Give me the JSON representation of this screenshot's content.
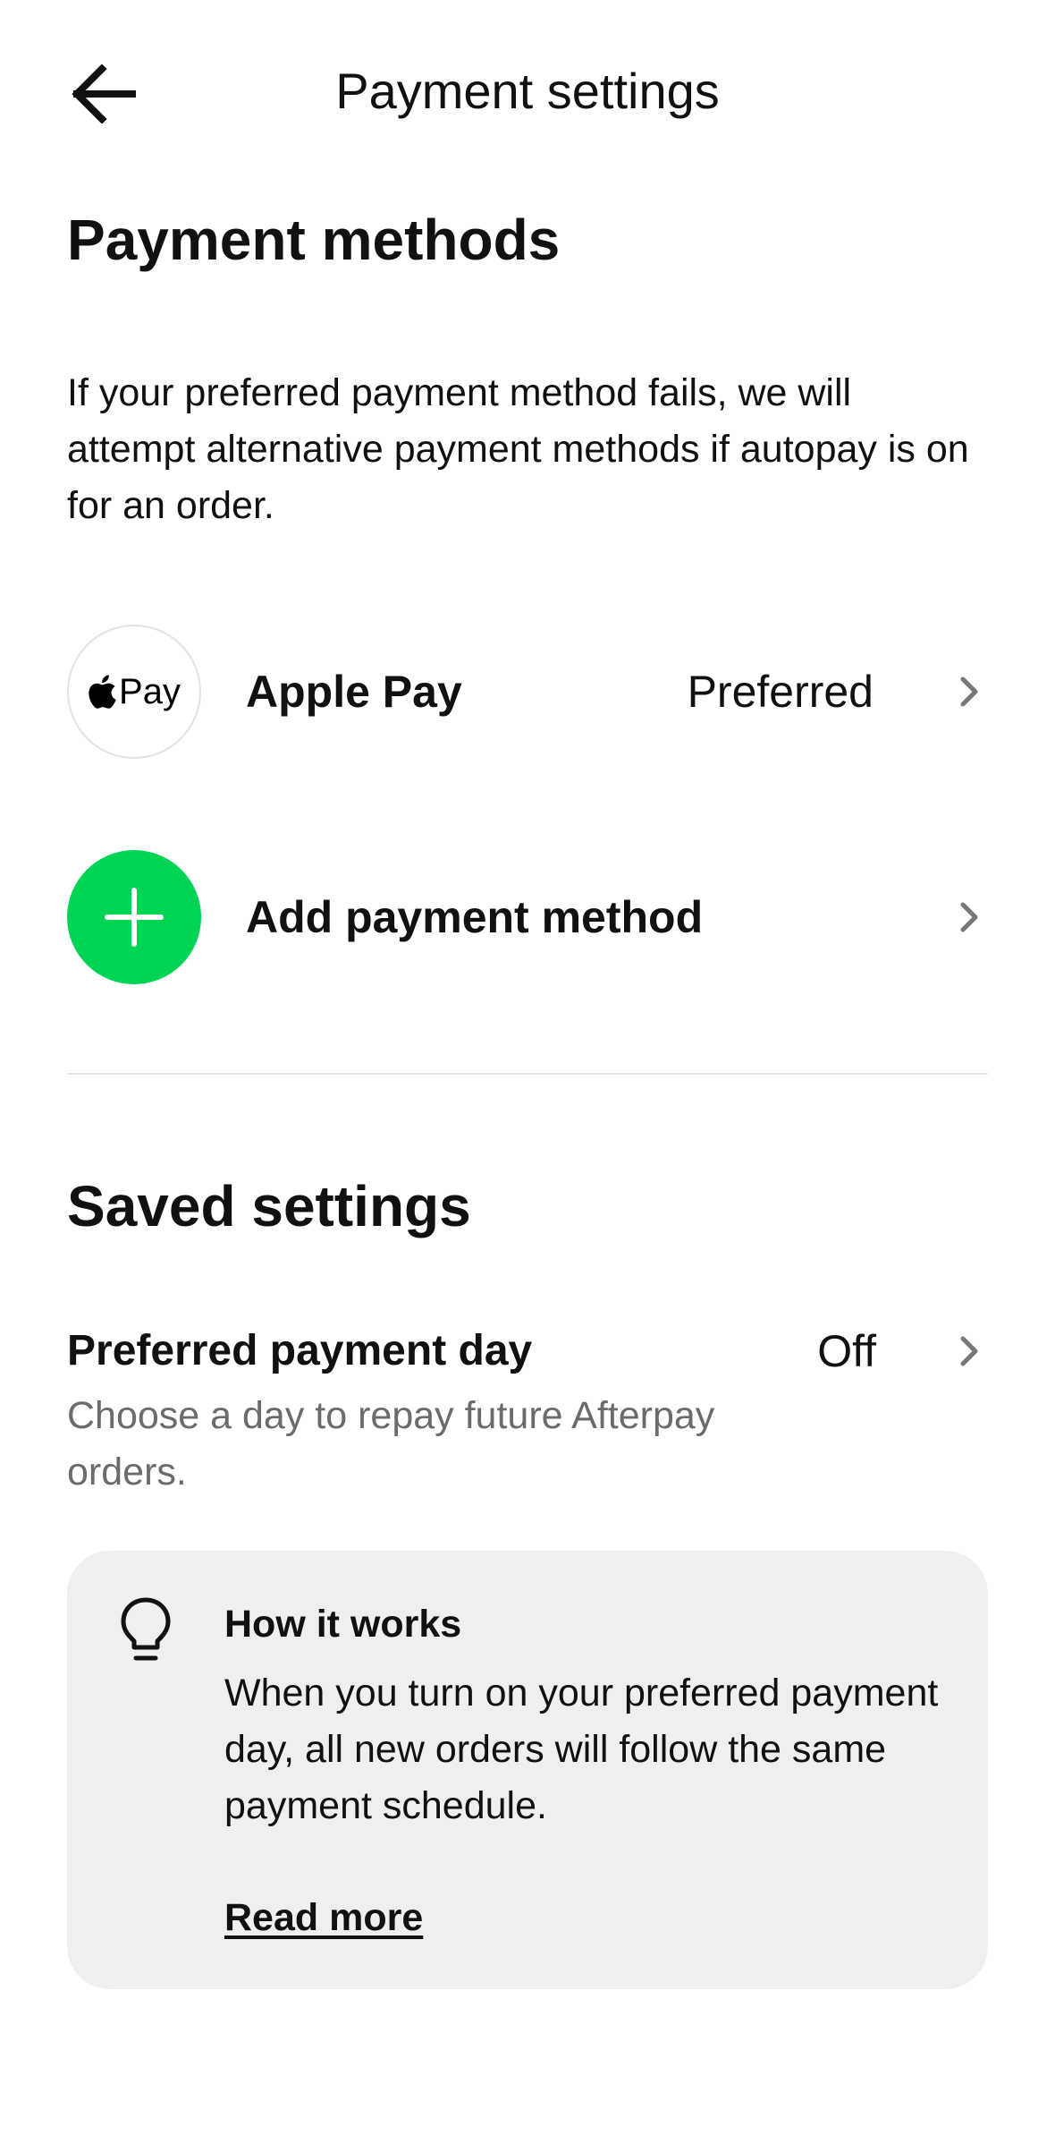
{
  "header": {
    "title": "Payment settings"
  },
  "payment_methods": {
    "heading": "Payment methods",
    "description": "If your preferred payment method fails, we will attempt alternative payment methods if autopay is on for an order.",
    "items": [
      {
        "logo_text": "Pay",
        "label": "Apple Pay",
        "status": "Preferred",
        "icon": "apple-logo-icon"
      }
    ],
    "add_label": "Add payment method",
    "add_color": "#00d455"
  },
  "saved_settings": {
    "heading": "Saved settings",
    "preferred_day": {
      "title": "Preferred payment day",
      "subtitle": "Choose a day to repay future Afterpay orders.",
      "value": "Off"
    },
    "info_card": {
      "title": "How it works",
      "body": "When you turn on your preferred payment day, all new orders will follow the same payment schedule.",
      "link": "Read more",
      "icon": "lightbulb-icon",
      "background": "#efefef"
    }
  }
}
